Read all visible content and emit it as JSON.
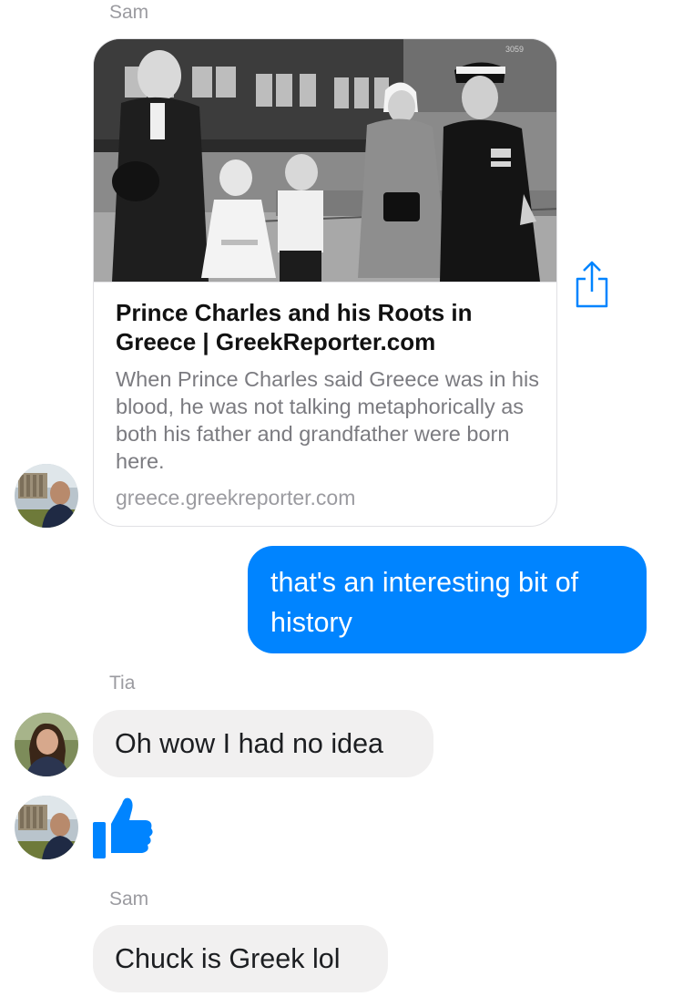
{
  "thread": {
    "messages": [
      {
        "sender": "Sam",
        "link_preview": {
          "title": "Prince Charles and his Roots in Greece | GreekReporter.com",
          "description": "When Prince Charles said Greece was in his blood, he was not talking metaphorically as both his father and grandfather were born here.",
          "domain": "greece.greekreporter.com",
          "image_icon": "historic-family-photo",
          "image_text": "3059"
        }
      },
      {
        "outgoing": true,
        "text": "that's an interesting bit of history"
      },
      {
        "sender": "Tia",
        "text": "Oh wow I had no idea"
      },
      {
        "reaction": "thumbs-up-like",
        "icon": "like-icon"
      },
      {
        "sender": "Sam",
        "text": "Chuck is Greek lol"
      }
    ]
  },
  "colors": {
    "outgoing_bubble": "#0084ff",
    "incoming_bubble": "#f1f0f0",
    "sender_label": "#9b9ba0",
    "accent": "#0084ff"
  }
}
